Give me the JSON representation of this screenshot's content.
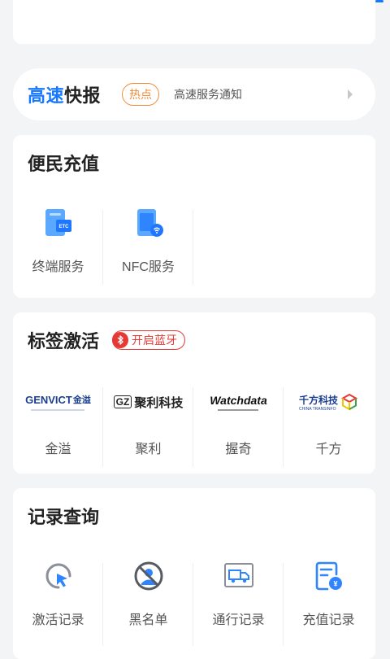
{
  "news": {
    "brand_blue": "高速",
    "brand_dark": "快报",
    "hot_tag": "热点",
    "headline": "高速服务通知"
  },
  "recharge": {
    "title": "便民充值",
    "items": [
      {
        "label": "终端服务",
        "icon": "etc-card-icon"
      },
      {
        "label": "NFC服务",
        "icon": "nfc-phone-icon"
      }
    ]
  },
  "activate": {
    "title": "标签激活",
    "bluetooth": {
      "label": "开启蓝牙",
      "icon": "bluetooth-icon"
    },
    "items": [
      {
        "label": "金溢",
        "logo_main": "GENVICT",
        "logo_cn": "金溢"
      },
      {
        "label": "聚利",
        "logo_main": "聚利科技",
        "logo_prefix": "GZ"
      },
      {
        "label": "握奇",
        "logo_main": "Watchdata"
      },
      {
        "label": "千方",
        "logo_main": "千方科技",
        "logo_sub": "CHINA TRANSINFO"
      }
    ]
  },
  "records": {
    "title": "记录查询",
    "items": [
      {
        "label": "激活记录",
        "icon": "cursor-click-icon"
      },
      {
        "label": "黑名单",
        "icon": "blocked-user-icon"
      },
      {
        "label": "通行记录",
        "icon": "truck-icon"
      },
      {
        "label": "充值记录",
        "icon": "recharge-bill-icon"
      }
    ]
  },
  "colors": {
    "accent": "#1677ff",
    "hot": "#f08c3a",
    "bluetooth": "#e53935",
    "background": "#f3f4f6"
  }
}
